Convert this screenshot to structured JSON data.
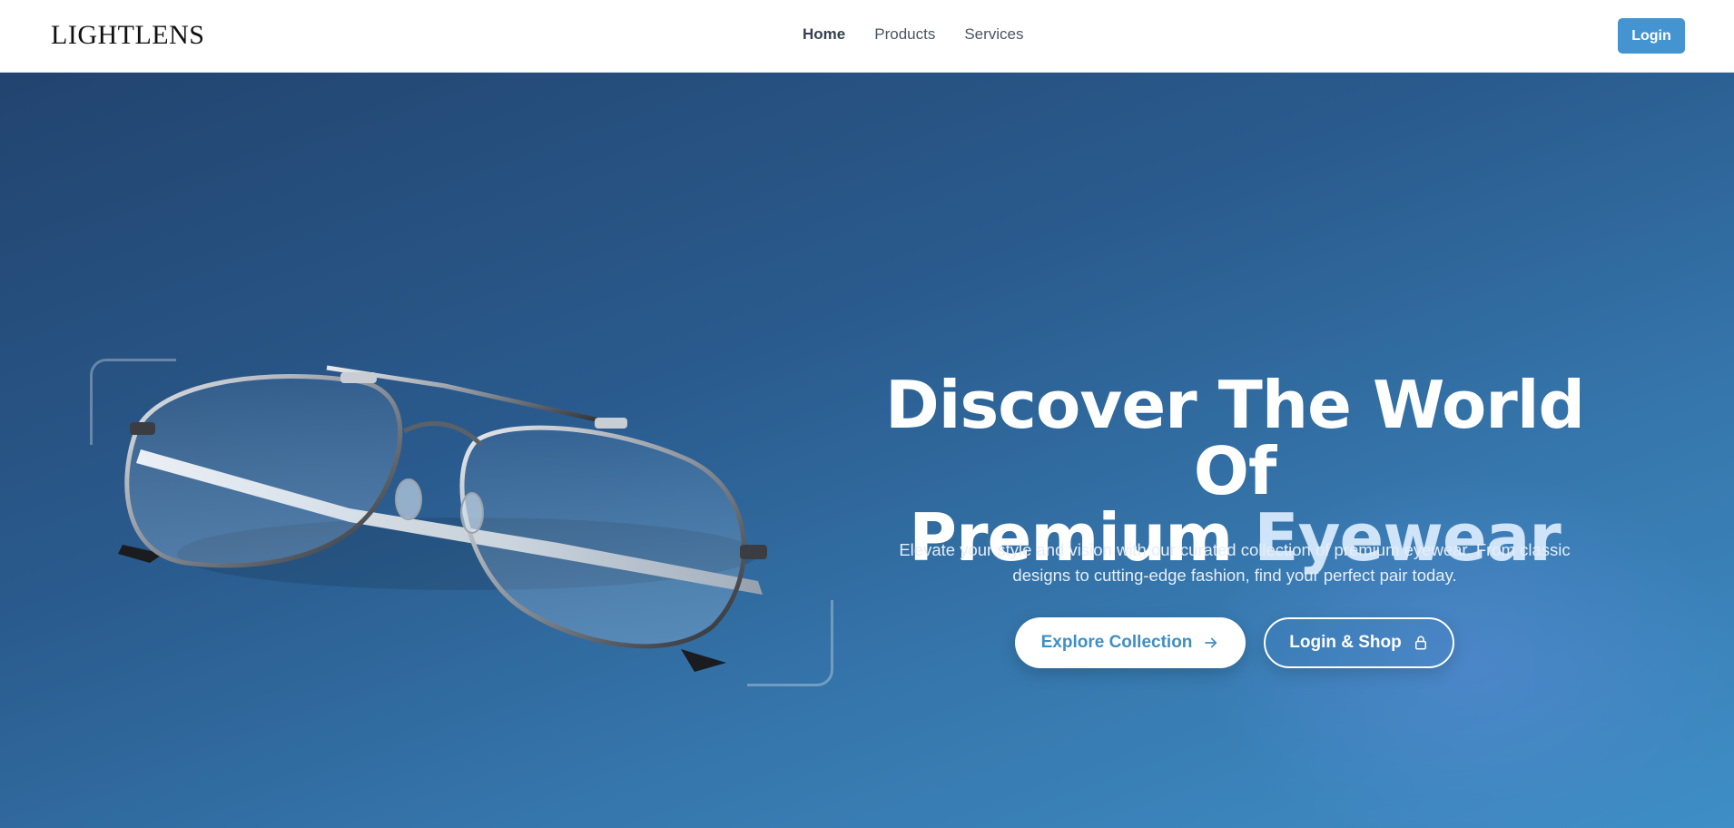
{
  "header": {
    "logo": "LIGHTLENS",
    "nav": [
      {
        "label": "Home",
        "active": true
      },
      {
        "label": "Products",
        "active": false
      },
      {
        "label": "Services",
        "active": false
      }
    ],
    "login_label": "Login"
  },
  "hero": {
    "title_line1": "Discover The World Of",
    "title_line2_plain": "Premium",
    "title_line2_accent": "Eyewear",
    "description": "Elevate your style and vision with our curated collection of premium eyewear. From classic designs to cutting-edge fashion, find your perfect pair today.",
    "primary_cta": "Explore Collection",
    "secondary_cta": "Login & Shop",
    "image_alt": "aviator-eyeglasses"
  },
  "icons": {
    "primary_cta_icon": "arrow-right-icon",
    "secondary_cta_icon": "lock-icon"
  },
  "colors": {
    "accent": "#4494d2",
    "title_accent": "#cfe4f8",
    "hero_dark": "#22446f",
    "hero_light": "#3f8ec6"
  }
}
